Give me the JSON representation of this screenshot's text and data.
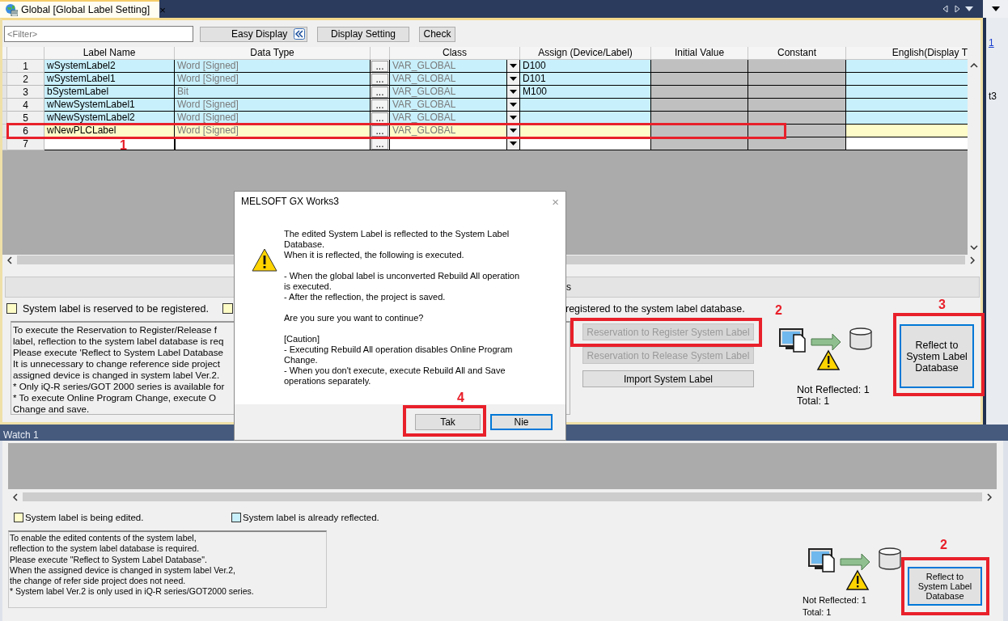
{
  "tab": {
    "title": "Global [Global Label Setting]",
    "close": "×"
  },
  "toolbar": {
    "filter_placeholder": "<Filter>",
    "easy_display": "Easy Display",
    "display_setting": "Display Setting",
    "check": "Check"
  },
  "grid": {
    "columns": [
      "Label Name",
      "Data Type",
      "Class",
      "Assign (Device/Label)",
      "Initial Value",
      "Constant",
      "English(Display T"
    ],
    "rows": [
      {
        "number": "1",
        "label_name": "wSystemLabel2",
        "data_type": "Word [Signed]",
        "browse": "...",
        "class": "VAR_GLOBAL",
        "assign": "D100",
        "reflected": true,
        "editing": false
      },
      {
        "number": "2",
        "label_name": "wSystemLabel1",
        "data_type": "Word [Signed]",
        "browse": "...",
        "class": "VAR_GLOBAL",
        "assign": "D101",
        "reflected": true,
        "editing": false
      },
      {
        "number": "3",
        "label_name": "bSystemLabel",
        "data_type": "Bit",
        "browse": "...",
        "class": "VAR_GLOBAL",
        "assign": "M100",
        "reflected": true,
        "editing": false
      },
      {
        "number": "4",
        "label_name": "wNewSystemLabel1",
        "data_type": "Word [Signed]",
        "browse": "...",
        "class": "VAR_GLOBAL",
        "reflected": true,
        "editing": false
      },
      {
        "number": "5",
        "label_name": "wNewSystemLabel2",
        "data_type": "Word [Signed]",
        "browse": "...",
        "class": "VAR_GLOBAL",
        "reflected": true,
        "editing": false
      },
      {
        "number": "6",
        "label_name": "wNewPLCLabel",
        "data_type": "Word [Signed]",
        "browse": "...",
        "class": "VAR_GLOBAL",
        "reflected": false,
        "editing": true,
        "annotation": "1"
      },
      {
        "number": "7",
        "browse": "...",
        "reflected": false,
        "editing": false
      }
    ]
  },
  "action_bar": {
    "label": "s"
  },
  "legend_top": [
    {
      "text": "System label is reserved to be registered.",
      "color": "#fdfcc6"
    },
    {
      "color": "#fdfcc6"
    }
  ],
  "legend_tail": "registered to the system label database.",
  "info_top": [
    "To execute the Reservation to Register/Release f",
    "label, reflection to the system label database is req",
    "Please execute 'Reflect to System Label Database",
    "It is unnecessary to change reference side project",
    "assigned device is changed in system label Ver.2.",
    "* Only iQ-R series/GOT 2000 series is available for",
    "* To execute Online Program Change, execute O",
    "Change and save."
  ],
  "actions": [
    {
      "label": "Reservation to Register System Label",
      "disabled": true,
      "annotation": "2"
    },
    {
      "label": "Reservation to Release System Label",
      "disabled": true
    },
    {
      "label": "Import System Label",
      "disabled": false
    }
  ],
  "status": {
    "not_reflected": "Not Reflected: 1",
    "total": "Total: 1"
  },
  "reflect_button": {
    "label": "Reflect to System Label Database",
    "annotation": "3"
  },
  "side_strip": [
    "1",
    "t3"
  ],
  "watch": {
    "title": "Watch 1",
    "legend": [
      {
        "text": "System label is being edited.",
        "color": "#fefcc8"
      },
      {
        "text": "System label is already reflected.",
        "color": "#c8f0fc"
      }
    ],
    "info": [
      "To enable the edited contents of the system label,",
      "reflection to the system label database is required.",
      "Please execute \"Reflect to System Label Database\".",
      "When the assigned device is changed in system label Ver.2,",
      "the change of refer side project does not need.",
      "* System label Ver.2 is only used in iQ-R series/GOT2000 series."
    ],
    "status": {
      "not_reflected": "Not Reflected: 1",
      "total": "Total: 1"
    },
    "reflect_button": {
      "label": "Reflect to System Label Database",
      "annotation": "2"
    }
  },
  "dialog": {
    "title": "MELSOFT GX Works3",
    "close": "×",
    "paragraphs": [
      "The edited System Label is reflected to the System Label\nDatabase.\nWhen it is reflected, the following is executed.",
      "- When the global label is unconverted Rebuild All operation\nis executed.\n- After the reflection, the project is saved.",
      "Are you sure you want to continue?",
      "[Caution]\n- Executing Rebuild All operation disables Online Program\nChange.\n- When you don't execute, execute Rebuild All and Save\noperations separately."
    ],
    "buttons": [
      {
        "label": "Tak",
        "default": false,
        "annotation": "4"
      },
      {
        "label": "Nie",
        "default": true
      }
    ]
  }
}
